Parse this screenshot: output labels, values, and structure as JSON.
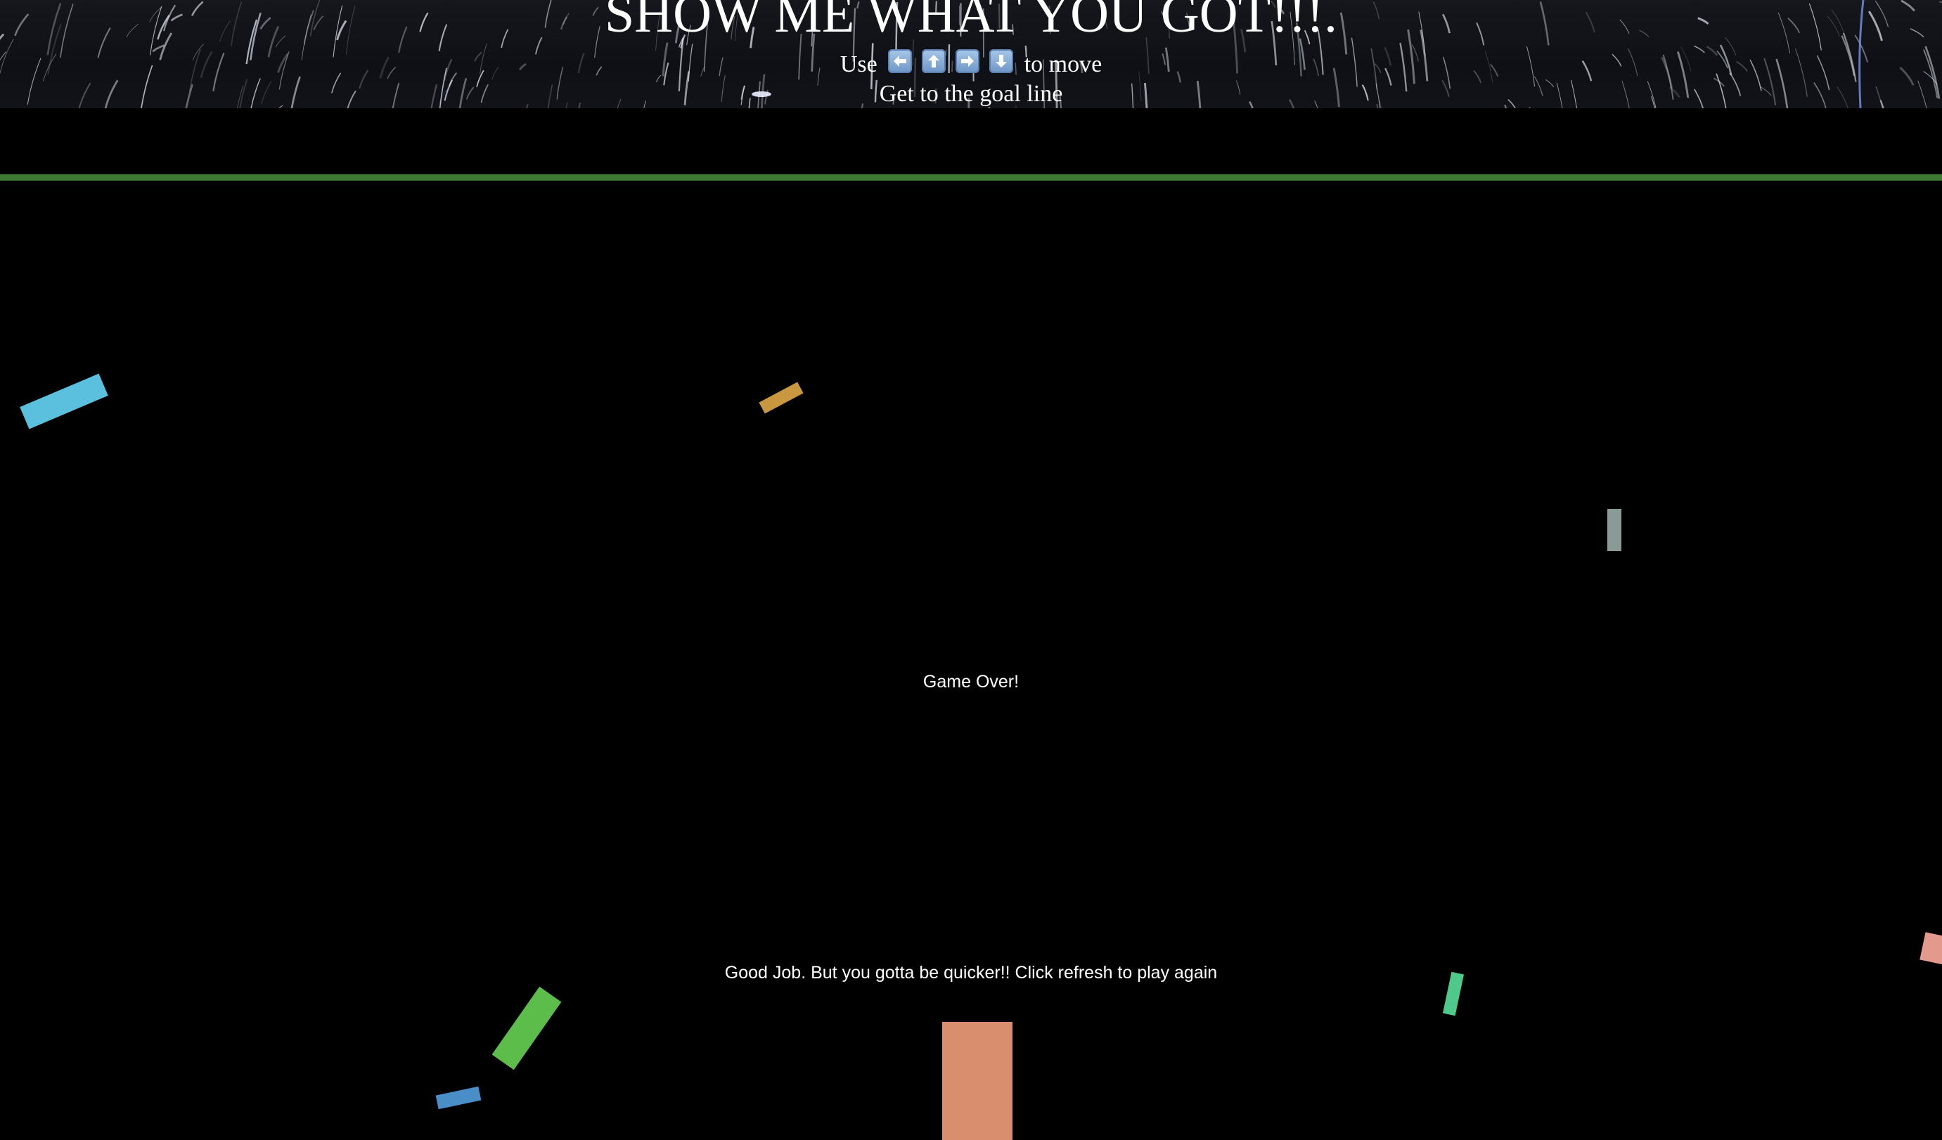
{
  "header": {
    "title": "SHOW ME WHAT YOU GOT!!!.",
    "instructions_prefix": "Use",
    "instructions_suffix": "to move",
    "goal_text": "Get to the goal line",
    "keys": [
      "left-arrow-key-icon",
      "up-arrow-key-icon",
      "right-arrow-key-icon",
      "down-arrow-key-icon"
    ]
  },
  "game": {
    "goal_line_color": "#3e7a34",
    "game_over_text": "Game Over!",
    "result_text": "Good Job. But you gotta be quicker!! Click refresh to play again",
    "player_color": "#d98f6e",
    "obstacles": [
      {
        "name": "obstacle-cyan",
        "color": "#5bc0de"
      },
      {
        "name": "obstacle-orange",
        "color": "#c8973f"
      },
      {
        "name": "obstacle-gray",
        "color": "#8a9a96"
      },
      {
        "name": "obstacle-green",
        "color": "#5cbd4a"
      },
      {
        "name": "obstacle-blue",
        "color": "#4a8ec8"
      },
      {
        "name": "obstacle-mint",
        "color": "#4fc98a"
      },
      {
        "name": "obstacle-salmon",
        "color": "#e39a8c"
      }
    ]
  }
}
